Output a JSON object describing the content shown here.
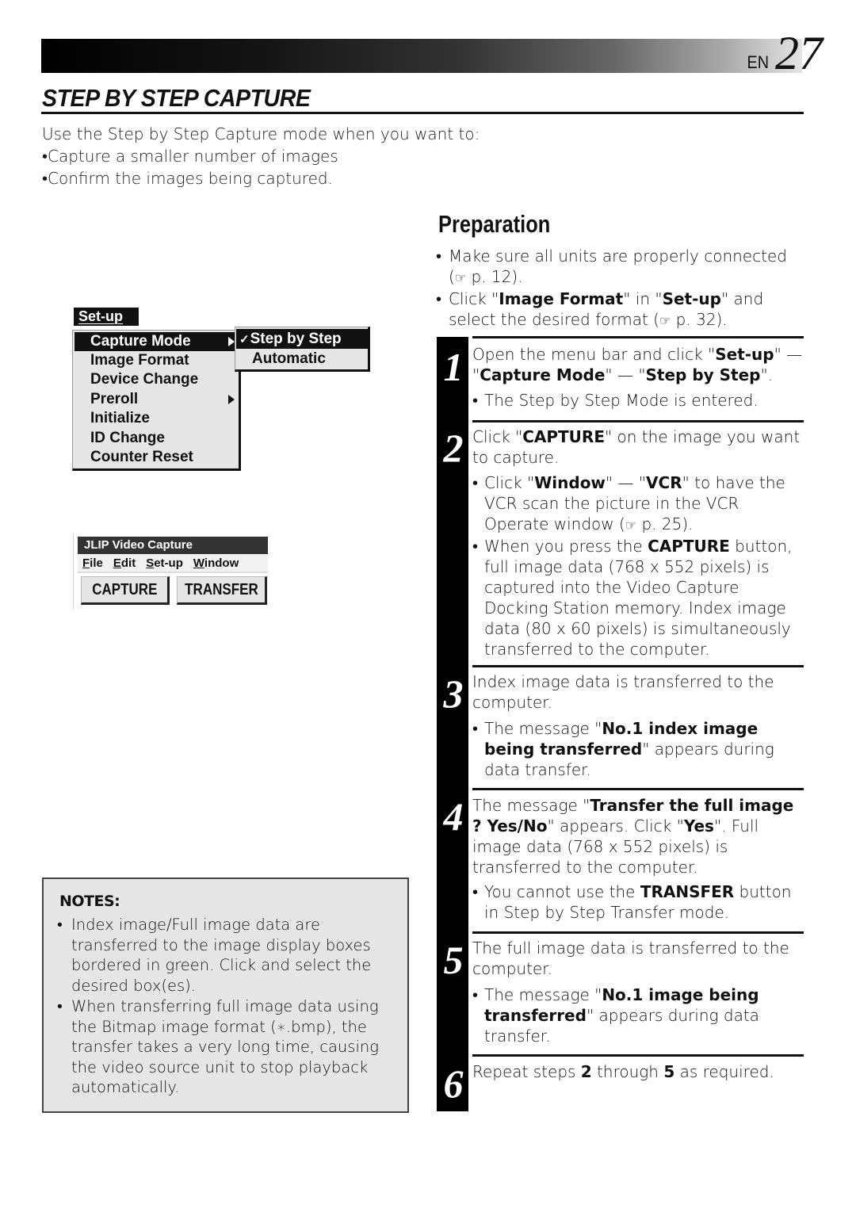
{
  "header": {
    "lang": "EN",
    "page_number": "27"
  },
  "section_title": "STEP BY STEP CAPTURE",
  "intro": {
    "lead": "Use the Step by Step Capture mode when you want to:",
    "bullets": [
      "Capture a smaller number of images",
      "Confirm the images being captured."
    ]
  },
  "bullet_char": "•",
  "ref_icon": "☞",
  "setup_menu": {
    "tab_label": "Set-up",
    "items": [
      {
        "label": "Capture Mode",
        "has_submenu": true,
        "active": true
      },
      {
        "label": "Image Format"
      },
      {
        "label": "Device Change"
      },
      {
        "label": "Preroll",
        "has_submenu": true
      },
      {
        "label": "Initialize"
      },
      {
        "label": "ID Change"
      },
      {
        "label": "Counter Reset"
      }
    ],
    "submenu": {
      "check_mark": "✓",
      "items": [
        {
          "label": "Step by Step",
          "checked": true
        },
        {
          "label": "Automatic"
        }
      ]
    }
  },
  "jlip_window": {
    "title": "JLIP Video Capture",
    "menu": [
      "File",
      "Edit",
      "Set-up",
      "Window"
    ],
    "buttons": {
      "capture": "CAPTURE",
      "transfer": "TRANSFER"
    }
  },
  "notes": {
    "title": "NOTES:",
    "items": [
      "Index image/Full image data are transferred to the image display boxes bordered in green.  Click and select the desired box(es).",
      "When transferring full image data using the Bitmap image format (∗.bmp), the transfer takes a very long time, causing the video source unit to stop playback automatically."
    ]
  },
  "preparation": {
    "title": "Preparation",
    "b1_text": "Make sure all units are properly connected",
    "b1_ref": "p. 12).",
    "b2_pre": "Click \"",
    "b2_bold1": "Image Format",
    "b2_mid": "\" in \"",
    "b2_bold2": "Set-up",
    "b2_post": "\" and select the desired format (",
    "b2_ref": "p. 32)."
  },
  "steps": [
    {
      "number": "1",
      "p1": "Open the menu bar and click \"",
      "b1": "Set-up",
      "p2": "\" — \"",
      "b2": "Capture Mode",
      "p3": "\" — \"",
      "b3": "Step by Step",
      "p4": "\".",
      "sub": [
        "The Step by Step Mode is entered."
      ]
    },
    {
      "number": "2",
      "p1": "Click \"",
      "b1": "CAPTURE",
      "p2": "\" on the image you want to capture.",
      "sub1_p1": "Click \"",
      "sub1_b1": "Window",
      "sub1_p2": "\" — \"",
      "sub1_b2": "VCR",
      "sub1_p3": "\" to have the VCR scan the picture in the VCR Operate window (",
      "sub1_ref": "p. 25).",
      "sub2_p1": "When you press the ",
      "sub2_b1": "CAPTURE",
      "sub2_p2": " button, full image data (768 x 552 pixels) is captured into the Video Capture Docking Station memory. Index image data (80 x 60 pixels) is simultaneously transferred to the computer."
    },
    {
      "number": "3",
      "text": "Index image data is transferred to the computer.",
      "sub1_p1": "The message \"",
      "sub1_b1": "No.1 index image being transferred",
      "sub1_p2": "\" appears during data transfer."
    },
    {
      "number": "4",
      "p1": "The message \"",
      "b1": "Transfer the full image ? Yes/No",
      "p2": "\" appears.  Click \"",
      "b2": "Yes",
      "p3": "\". Full image data (768 x 552 pixels) is transferred to the computer.",
      "sub1_p1": "You cannot use the ",
      "sub1_b1": "TRANSFER",
      "sub1_p2": " button in Step by Step Transfer mode."
    },
    {
      "number": "5",
      "text": "The full image data is transferred to the computer.",
      "sub1_p1": "The message \"",
      "sub1_b1": "No.1 image being transferred",
      "sub1_p2": "\" appears during data transfer."
    },
    {
      "number": "6",
      "p1": "Repeat steps ",
      "b1": "2",
      "p2": " through ",
      "b2": "5",
      "p3": " as required."
    }
  ]
}
